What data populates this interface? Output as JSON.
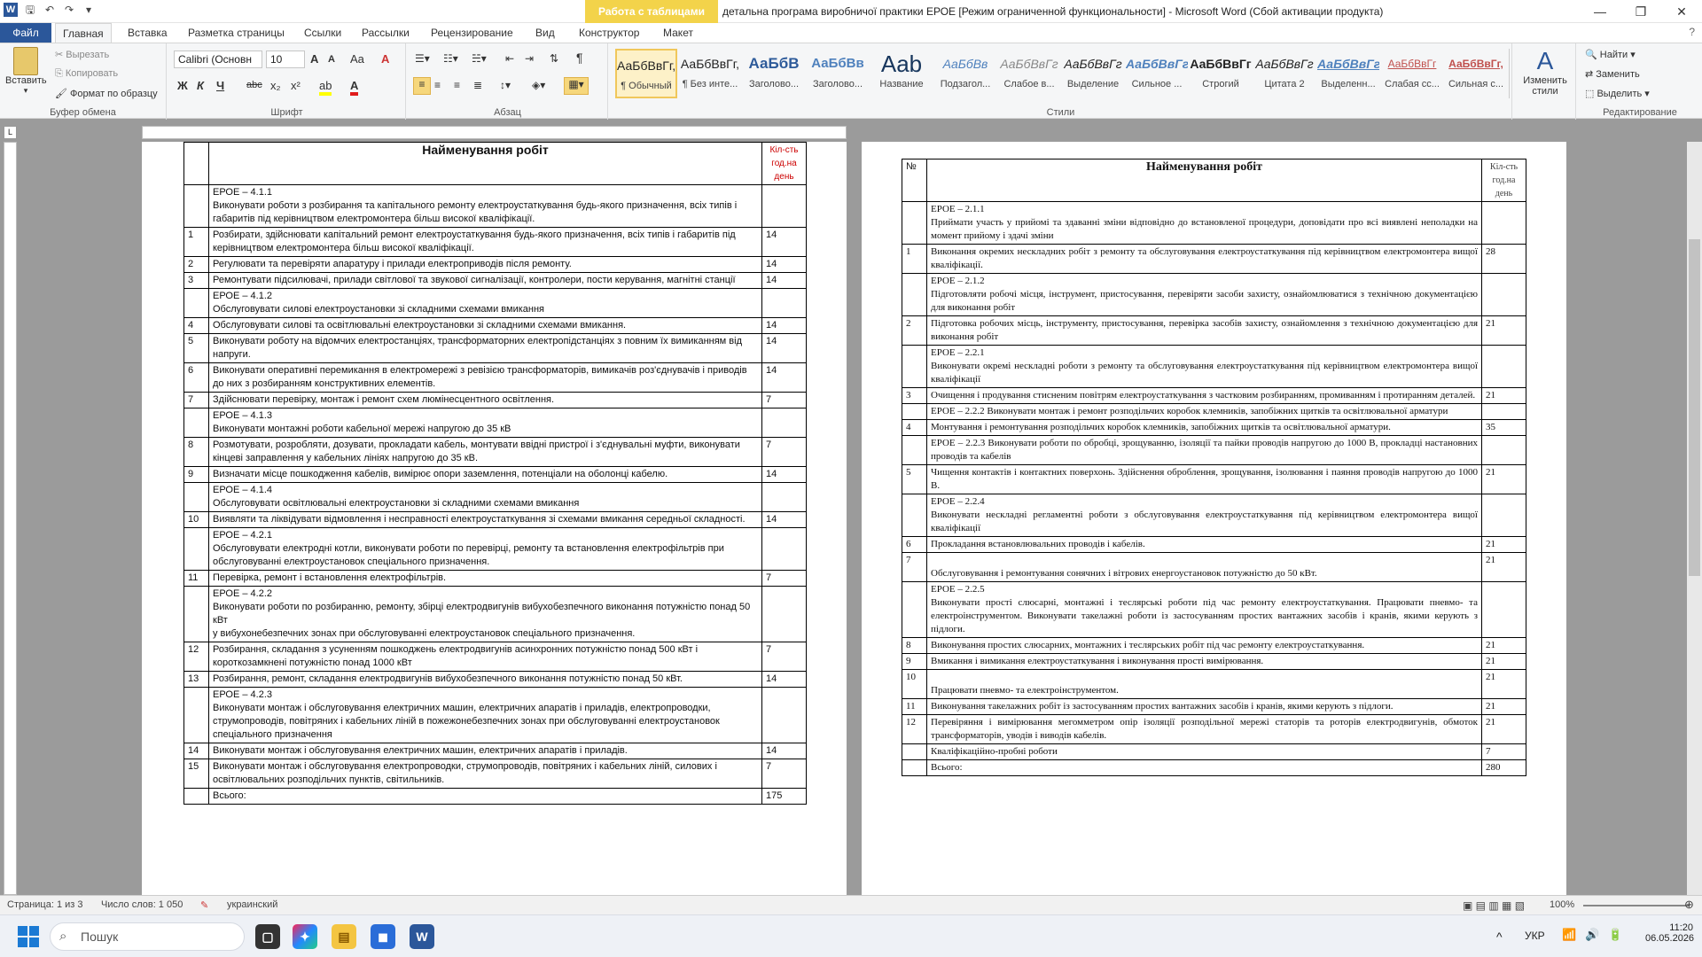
{
  "window": {
    "title": "детальна програма виробничої практики ЕРОЕ [Режим ограниченной функциональности]  -  Microsoft Word (Сбой активации продукта)",
    "context_tab_header": "Работа с таблицами"
  },
  "tabs": [
    "Файл",
    "Главная",
    "Вставка",
    "Разметка страницы",
    "Ссылки",
    "Рассылки",
    "Рецензирование",
    "Вид",
    "Конструктор",
    "Макет"
  ],
  "ribbon": {
    "clipboard": {
      "paste": "Вставить",
      "cut": "Вырезать",
      "copy": "Копировать",
      "format_painter": "Формат по образцу",
      "label": "Буфер обмена"
    },
    "font": {
      "name": "Calibri (Основн",
      "size": "10",
      "label": "Шрифт",
      "bold": "Ж",
      "italic": "К",
      "underline": "Ч",
      "strike": "abc",
      "sub": "x₂",
      "sup": "x²",
      "grow": "A",
      "shrink": "A",
      "case": "Aa",
      "clear": "A",
      "highlight": "ab",
      "color": "A"
    },
    "paragraph": {
      "label": "Абзац"
    },
    "styles": {
      "label": "Стили",
      "items": [
        {
          "sample": "АаБбВвГг,",
          "name": "¶ Обычный"
        },
        {
          "sample": "АаБбВвГг,",
          "name": "¶ Без инте..."
        },
        {
          "sample": "АаБбВ",
          "name": "Заголово..."
        },
        {
          "sample": "АаБбВв",
          "name": "Заголово..."
        },
        {
          "sample": "Aab",
          "name": "Название"
        },
        {
          "sample": "АаБбВв",
          "name": "Подзагол..."
        },
        {
          "sample": "АаБбВвГг",
          "name": "Слабое в..."
        },
        {
          "sample": "АаБбВвГг",
          "name": "Выделение"
        },
        {
          "sample": "АаБбВвГг",
          "name": "Сильное ..."
        },
        {
          "sample": "АаБбВвГг",
          "name": "Строгий"
        },
        {
          "sample": "АаБбВвГг",
          "name": "Цитата 2"
        },
        {
          "sample": "АаБбВвГг",
          "name": "Выделенн..."
        },
        {
          "sample": "АаБбВвГг",
          "name": "Слабая сс..."
        },
        {
          "sample": "АаБбВвГг,",
          "name": "Сильная с..."
        }
      ],
      "change": "Изменить стили"
    },
    "editing": {
      "find": "Найти",
      "replace": "Заменить",
      "select": "Выделить",
      "label": "Редактирование"
    }
  },
  "page1": {
    "header_name": "Найменування робіт",
    "header_hours": "Кіл-сть год.на день",
    "rows": [
      {
        "n": "",
        "text": "ЕРОЕ  –  4.1.1\nВиконувати  роботи  з розбирання та капітального ремонту електроустаткування будь-якого  призначення,  всіх типів і габаритів під керівництвом  електромонтера більш високої кваліфікації.",
        "h": ""
      },
      {
        "n": "1",
        "text": "Розбирати, здійснювати  капітальний  ремонт електроустаткування будь-якого призначення, всіх типів і габаритів під керівництвом електромонтера більш високої кваліфікації.",
        "h": "14"
      },
      {
        "n": "2",
        "text": "Регулювати та перевіряти апаратуру і прилади електроприводів після ремонту.",
        "h": "14"
      },
      {
        "n": "3",
        "text": "Ремонтувати  підсилювачі, прилади світлової та звукової сигналізації, контролери, пости керування, магнітні станції",
        "h": "14"
      },
      {
        "n": "",
        "text": "ЕРОЕ  –  4.1.2\nОбслуговувати силові електроустановки зі складними схемами вмикання",
        "h": ""
      },
      {
        "n": "4",
        "text": "Обслуговувати силові та освітлювальні  електроустановки зі складними схемами вмикання.",
        "h": "14"
      },
      {
        "n": "5",
        "text": "Виконувати роботу на відомчих електростанціях, трансформаторних електропідстанціях з повним їх вимиканням  від напруги.",
        "h": "14"
      },
      {
        "n": "6",
        "text": "Виконувати оперативні перемикання в електромережі з ревізією трансформаторів, вимикачів роз'єднувачів і приводів до них з розбиранням конструктивних елементів.",
        "h": "14"
      },
      {
        "n": "7",
        "text": "Здійснювати  перевірку, монтаж і ремонт схем люмінесцентного освітлення.",
        "h": "7"
      },
      {
        "n": "",
        "text": "ЕРОЕ  –  4.1.3\nВиконувати  монтажні роботи кабельної мережі напругою до 35 кВ",
        "h": ""
      },
      {
        "n": "8",
        "text": "Розмотувати, розробляти, дозувати, прокладати кабель, монтувати  ввідні пристрої і з'єднувальні муфти, виконувати  кінцеві заправлення у кабельних лініях напругою до 35 кВ.",
        "h": "7"
      },
      {
        "n": "9",
        "text": "Визначати  місце пошкодження кабелів, вимірює опори заземлення, потенціали на оболонці кабелю.",
        "h": "14"
      },
      {
        "n": "",
        "text": "ЕРОЕ – 4.1.4\nОбслуговувати освітлювальні електроустановки зі складними схемами вмикання",
        "h": ""
      },
      {
        "n": "10",
        "text": " Виявляти та ліквідувати  відмовлення і несправності електроустаткування  зі схемами вмикання  середньої складності.",
        "h": "14"
      },
      {
        "n": "",
        "text": "ЕРОЕ  –  4.2.1\nОбслуговувати електродні котли, виконувати  роботи по перевірці, ремонту та встановлення електрофільтрів при обслуговуванні електроустановок спеціального призначення.",
        "h": ""
      },
      {
        "n": "11",
        "text": "Перевірка, ремонт і встановлення електрофільтрів.",
        "h": "7"
      },
      {
        "n": "",
        "text": "ЕРОЕ  –  4.2.2\nВиконувати  роботи по розбиранню, ремонту, збірці електродвигунів вибухобезпечного виконання потужністю понад 50 кВт\nу вибухонебезпечних зонах при обслуговуванні електроустановок спеціального призначення.",
        "h": ""
      },
      {
        "n": "12",
        "text": "Розбирання, складання  з усуненням пошкоджень електродвигунів  асинхронних  потужністю понад 500 кВт і короткозамкнені потужністю понад 1000 кВт",
        "h": "7"
      },
      {
        "n": "13",
        "text": "Розбирання, ремонт, складання електродвигунів вибухобезпечного виконання  потужністю понад 50 кВт.",
        "h": "14"
      },
      {
        "n": "",
        "text": "ЕРОЕ  –  4.2.3\nВиконувати монтаж і обслуговування електричних машин, електричних апаратів  і приладів, електропроводки, струмопроводів,  повітряних і кабельних ліній  в пожежонебезпечних зонах при обслуговуванні електроустановок спеціального призначення",
        "h": ""
      },
      {
        "n": "14",
        "text": "Виконувати монтаж і обслуговування електричних машин, електричних апаратів  і приладів.",
        "h": "14"
      },
      {
        "n": "15",
        "text": "Виконувати монтаж і обслуговування електропроводки, струмопроводів, повітряних і кабельних ліній, силових і освітлювальних  розподільчих пунктів,  світильників.",
        "h": "7"
      },
      {
        "n": "",
        "text": "Всього:",
        "h": "175"
      }
    ]
  },
  "page2": {
    "header_num": "№",
    "header_name": "Найменування робіт",
    "header_hours": "Кіл-сть год.на день",
    "rows": [
      {
        "n": "",
        "text": "ЕРОЕ  –  2.1.1\nПриймати участь у прийомі та здаванні зміни відповідно до встановленої процедури, доповідати про всі виявлені неполадки на момент прийому і здачі зміни",
        "h": ""
      },
      {
        "n": "1",
        "text": "Виконання   окремих   нескладних  робіт   з ремонту та обслуговування електроустаткування під керівництвом електромонтера вищої кваліфікації.",
        "h": "28"
      },
      {
        "n": "",
        "text": "ЕРОЕ  –  2.1.2\nПідготовляти робочі місця, інструмент, пристосування, перевіряти засоби захисту, ознайомлюватися з технічною документацією для виконання робіт",
        "h": ""
      },
      {
        "n": "2",
        "text": "Підготовка   робочих місць, інструменту, пристосування, перевірка засобів захисту, ознайомлення з технічною документацією для виконання робіт",
        "h": "21"
      },
      {
        "n": "",
        "text": "ЕРОЕ  –   2.2.1\nВиконувати окремі нескладні роботи з ремонту та обслуговування електроустаткування під керівництвом електромонтера вищої кваліфікації",
        "h": ""
      },
      {
        "n": "3",
        "text": "Очищення   і  продування   стисненим повітрям електроустаткування  з  частковим  розбиранням,  промиванням і протиранням деталей.",
        "h": "21"
      },
      {
        "n": "",
        "text": "ЕРОЕ  –   2.2.2  Виконувати монтаж і ремонт розподільчих коробок клемників, запобіжних щитків та освітлювальної арматури",
        "h": ""
      },
      {
        "n": "4",
        "text": "Монтування  і ремонтування  розподільчих коробок  клемників, запобіжних щитків та освітлювальної арматури.",
        "h": "35"
      },
      {
        "n": "",
        "text": "ЕРОЕ  –   2.2.3  Виконувати роботи по обробці, зрощуванню, ізоляції та пайки проводів напругою до 1000 В, прокладці настановних проводів та кабелів",
        "h": ""
      },
      {
        "n": "5",
        "text": "Чищення контактів і контактних  поверхонь. Здійснення оброблення, зрощування, ізолювання і паяння  проводів напругою до 1000 В.",
        "h": "21"
      },
      {
        "n": "",
        "text": "ЕРОЕ  –   2.2.4\nВиконувати нескладні регламентні роботи з обслуговування електроустаткування під керівництвом електромонтера вищої кваліфікації",
        "h": ""
      },
      {
        "n": "6",
        "text": "Прокладання  встановлювальних проводів і кабелів.",
        "h": "21"
      },
      {
        "n": "7",
        "text": "\nОбслуговування і ремонтування сонячних  і вітрових енергоустановок потужністю до 50 кВт.",
        "h": "21"
      },
      {
        "n": "",
        "text": "ЕРОЕ  –   2.2.5\nВиконувати прості слюсарні, монтажні і теслярські роботи під час ремонту електроустаткування. Працювати пневмо- та електроінструментом. Виконувати такелажні роботи із застосуванням простих вантажних засобів і кранів, якими керують з підлоги.",
        "h": ""
      },
      {
        "n": "8",
        "text": "Виконування   простих слюсарних, монтажних і теслярських робіт  під час ремонту електроустаткування.",
        "h": "21"
      },
      {
        "n": "9",
        "text": "Вмикання  і вимикання електроустаткування і виконування  прості вимірювання.",
        "h": "21"
      },
      {
        "n": "10",
        "text": "\nПрацювати пневмо- та електроінструментом.",
        "h": "21"
      },
      {
        "n": "11",
        "text": "Виконування   такелажних   робіт із застосуванням простих вантажних засобів і кранів, якими керують з підлоги.",
        "h": "21"
      },
      {
        "n": "12",
        "text": "Перевіряння    і  вимірювання   мегомметром опір ізоляції розподільної мережі статорів та роторів електродвигунів, обмоток  трансформаторів, уводів і виводів кабелів.",
        "h": "21"
      },
      {
        "n": "",
        "text": "Кваліфікаційно-пробні  роботи",
        "h": "7"
      },
      {
        "n": "",
        "text": "Всього:",
        "h": "280"
      }
    ]
  },
  "status": {
    "page": "Страница: 1 из 3",
    "words": "Число слов: 1 050",
    "lang": "украинский",
    "zoom": "100%"
  },
  "taskbar": {
    "search": "Пошук",
    "lang": "УКР",
    "time": "11:20",
    "date": "06.05.2026"
  }
}
